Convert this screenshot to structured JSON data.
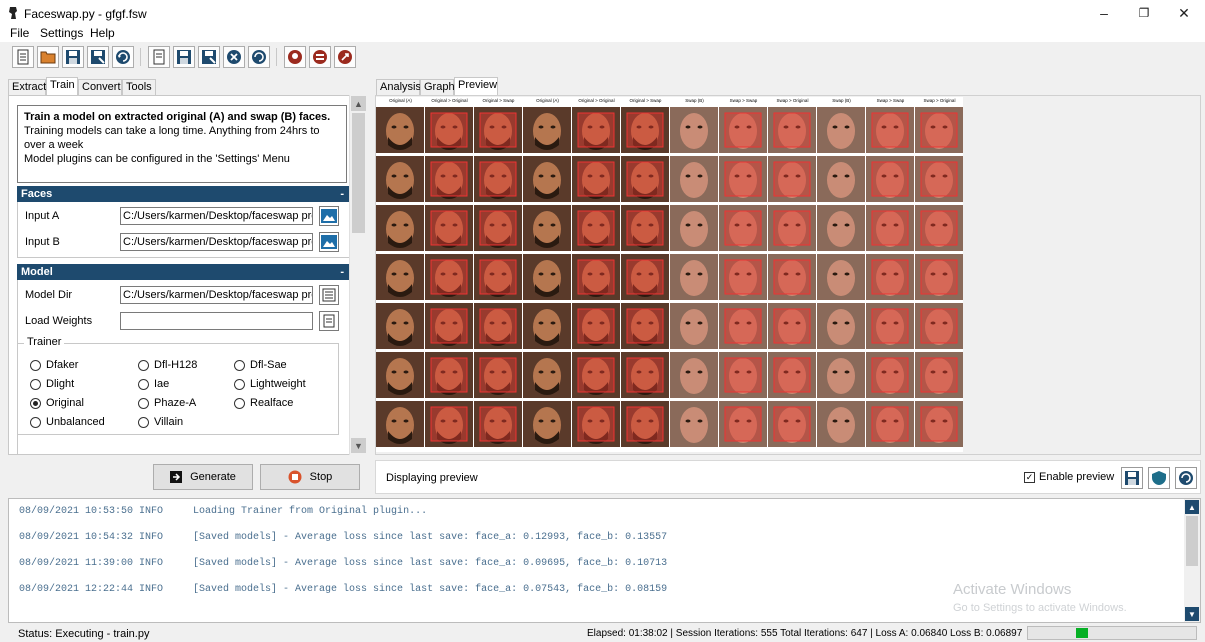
{
  "window": {
    "title": "Faceswap.py - gfgf.fsw",
    "minimize": "–",
    "restore": "❐",
    "close": "✕"
  },
  "menu": [
    "File",
    "Settings",
    "Help"
  ],
  "toolbar": {
    "icons": [
      "new-project-icon",
      "open-folder-icon",
      "save-icon",
      "save-as-icon",
      "reload-icon",
      "new-task-icon",
      "save-task-icon",
      "save-task-as-icon",
      "clear-task-icon",
      "reload-task-icon",
      "github-icon",
      "forum-icon",
      "update-icon"
    ]
  },
  "left_tabs": [
    "Extract",
    "Train",
    "Convert",
    "Tools"
  ],
  "active_left_tab": "Train",
  "info": {
    "headline": "Train a model on extracted original (A) and swap (B) faces.",
    "line1": "Training models can take a long time. Anything from 24hrs to over a week",
    "line2": "Model plugins can be configured in the 'Settings' Menu"
  },
  "faces": {
    "title": "Faces",
    "collapse": "-",
    "input_a_label": "Input A",
    "input_a_value": "C:/Users/karmen/Desktop/faceswap proj",
    "input_b_label": "Input B",
    "input_b_value": "C:/Users/karmen/Desktop/faceswap proj"
  },
  "model": {
    "title": "Model",
    "collapse": "-",
    "model_dir_label": "Model Dir",
    "model_dir_value": "C:/Users/karmen/Desktop/faceswap proj",
    "load_weights_label": "Load Weights",
    "load_weights_value": ""
  },
  "trainer": {
    "legend": "Trainer",
    "options": [
      "Dfaker",
      "Dfl-H128",
      "Dfl-Sae",
      "Dlight",
      "Iae",
      "Lightweight",
      "Original",
      "Phaze-A",
      "Realface",
      "Unbalanced",
      "Villain"
    ],
    "selected": "Original"
  },
  "left_buttons": {
    "generate": "Generate",
    "stop": "Stop"
  },
  "right_tabs": [
    "Analysis",
    "Graph",
    "Preview"
  ],
  "active_right_tab": "Preview",
  "preview": {
    "columns": [
      "Original (A)",
      "Original > Original",
      "Original > Swap",
      "Original (A)",
      "Original > Original",
      "Original > Swap",
      "Swap (B)",
      "Swap > Swap",
      "Swap > Original",
      "Swap (B)",
      "Swap > Swap",
      "Swap > Original"
    ]
  },
  "preview_status": {
    "text": "Displaying preview",
    "enable_label": "Enable preview",
    "enabled": true
  },
  "console": {
    "lines": [
      "08/09/2021 10:53:50 INFO     Loading Trainer from Original plugin...",
      "08/09/2021 10:54:32 INFO     [Saved models] - Average loss since last save: face_a: 0.12993, face_b: 0.13557",
      "08/09/2021 11:39:00 INFO     [Saved models] - Average loss since last save: face_a: 0.09695, face_b: 0.10713",
      "08/09/2021 12:22:44 INFO     [Saved models] - Average loss since last save: face_a: 0.07543, face_b: 0.08159"
    ],
    "watermark_title": "Activate Windows",
    "watermark_sub": "Go to Settings to activate Windows."
  },
  "status": {
    "left": "Status:  Executing - train.py",
    "right": "Elapsed: 01:38:02 | Session Iterations: 555  Total Iterations: 647 | Loss A: 0.06840  Loss B: 0.06897"
  },
  "colors": {
    "accent": "#1e4a6e",
    "progress": "#06b025",
    "console_text": "#4a6f8f"
  }
}
